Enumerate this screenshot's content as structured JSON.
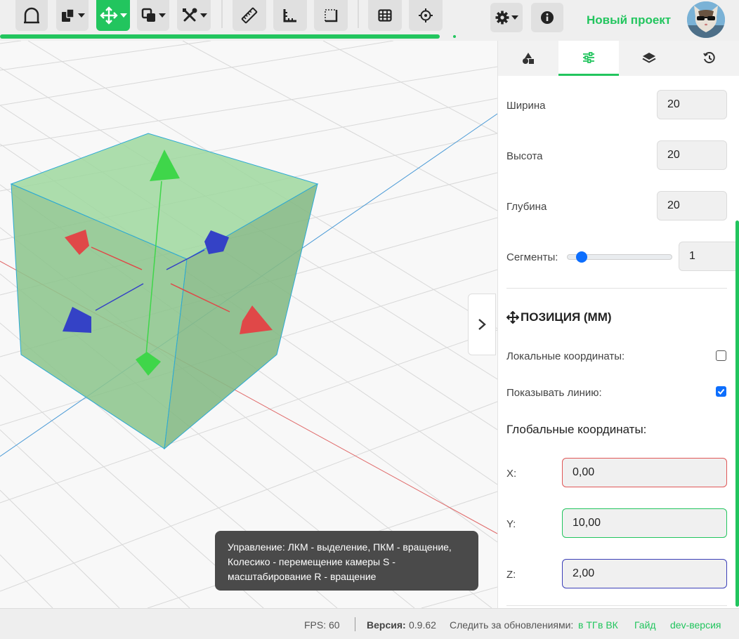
{
  "toolbar": {
    "tools": [
      {
        "name": "sketch-tool",
        "icon": "arch-icon"
      },
      {
        "name": "shapes-tool",
        "icon": "shapes-icon"
      },
      {
        "name": "move-tool",
        "icon": "move-icon",
        "active": true
      },
      {
        "name": "boolean-tool",
        "icon": "boolean-icon"
      },
      {
        "name": "tools-tool",
        "icon": "wrench-screwdriver-icon"
      },
      {
        "name": "ruler-tool",
        "icon": "ruler-icon"
      },
      {
        "name": "angle-tool",
        "icon": "angle-ruler-icon"
      },
      {
        "name": "dimension-tool",
        "icon": "dimension-box-icon"
      },
      {
        "name": "grid-tool",
        "icon": "grid-icon"
      },
      {
        "name": "target-tool",
        "icon": "crosshair-icon"
      }
    ],
    "progress": 1.0
  },
  "header": {
    "settings_icon": "gear-icon",
    "info_icon": "info-icon",
    "project_name": "Новый проект",
    "avatar": "avatar"
  },
  "panel": {
    "tabs": [
      {
        "icon": "shapes-icon",
        "active": false
      },
      {
        "icon": "sliders-icon",
        "active": true
      },
      {
        "icon": "layers-icon",
        "active": false
      },
      {
        "icon": "history-icon",
        "active": false
      }
    ],
    "width_label": "Ширина",
    "width_value": "20",
    "height_label": "Высота",
    "height_value": "20",
    "depth_label": "Глубина",
    "depth_value": "20",
    "segments_label": "Сегменты:",
    "segments_value": "1",
    "segments_level": 0.1,
    "position_title": "ПОЗИЦИЯ (ММ)",
    "local_coords_label": "Локальные координаты:",
    "local_coords_checked": false,
    "show_line_label": "Показывать линию:",
    "show_line_checked": true,
    "global_coords_label": "Глобальные координаты:",
    "x_label": "X:",
    "x_value": "0,00",
    "y_label": "Y:",
    "y_value": "10,00",
    "z_label": "Z:",
    "z_value": "2,00",
    "colors": {
      "x": "#e05757",
      "y": "#22c55e",
      "z": "#3b3fb8"
    }
  },
  "viewport": {
    "hint": "Управление: ЛКМ - выделение, ПКМ - вращение, Колесико - перемещение камеры S - масштабирование R - вращение",
    "collapse_icon": "chevron-right-icon"
  },
  "status": {
    "fps": "FPS: 60",
    "version_label": "Версия:",
    "version_value": "0.9.62",
    "follow_label": "Следить за обновлениями:",
    "tg_link": "в ТГ",
    "vk_link": "в ВК",
    "guide_link": "Гайд",
    "dev_link": "dev-версия"
  },
  "colors": {
    "accent": "#22c55e",
    "checkbox": "#0d6efd"
  }
}
